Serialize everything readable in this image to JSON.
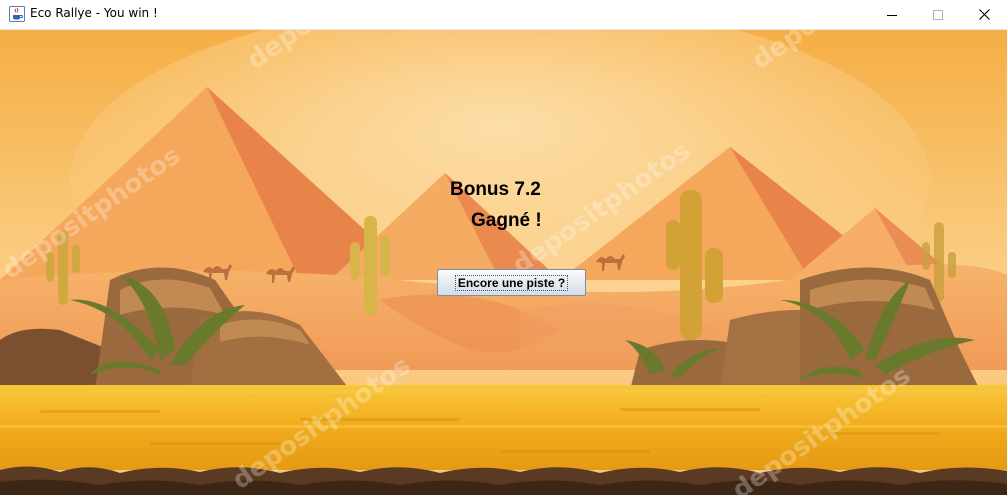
{
  "window": {
    "title": "Eco Rallye - You win !",
    "icons": {
      "app": "java-cup-icon",
      "minimize": "minimize-icon",
      "maximize": "maximize-icon",
      "close": "close-icon"
    }
  },
  "game": {
    "bonus_text": "Bonus 7.2",
    "result_text": "Gagné !",
    "retry_button_label": "Encore une piste ?",
    "watermark": "depositphotos",
    "scene": "desert-pyramids-background",
    "colors": {
      "sky_top": "#f6b14a",
      "sky_bottom": "#fbd79a",
      "pyramid_light": "#f8b45a",
      "pyramid_dark": "#e5793f",
      "sand": "#f3ae1e",
      "ground_dark": "#5a3a22"
    }
  }
}
